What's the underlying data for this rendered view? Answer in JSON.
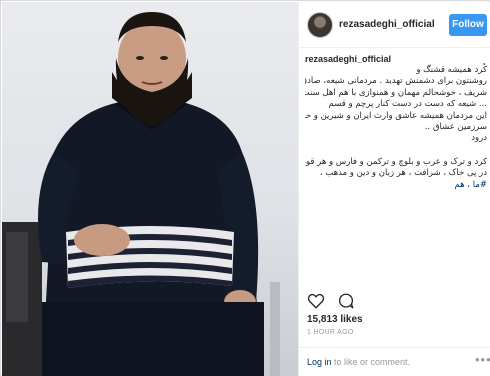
{
  "post": {
    "username": "rezasadeghi_official",
    "follow_label": "Follow",
    "caption_username": "rezasadeghi_official",
    "caption_lines": [
      "کُرد همیشه قشنگ و",
      "روشنتون برای دشمنش تهدید . مردمانی شیعه، صادق و",
      "شریف ، خوشحالم مهمان و همنوازی با هم اهل سنت و",
      "... شیعه که دست در دست کنار پرچم و قسم",
      "این مردمان همیشه عاشق وارث ایران و شیرین و حافظ",
      "سرزمین عشاق ..",
      "درود"
    ],
    "caption_lines_2": [
      "کرد و ترک و عرب و بلوچ و ترکمن و فارس و هر قومیتی",
      "در پی خاک ، شرافت ، هر زبان و دین و مذهب ،",
      "#ما ، هم"
    ],
    "likes": "15,813 likes",
    "time": "1 HOUR AGO",
    "login_link": "Log in",
    "login_text": " to like or comment.",
    "more_icon": "more-dots-icon"
  }
}
